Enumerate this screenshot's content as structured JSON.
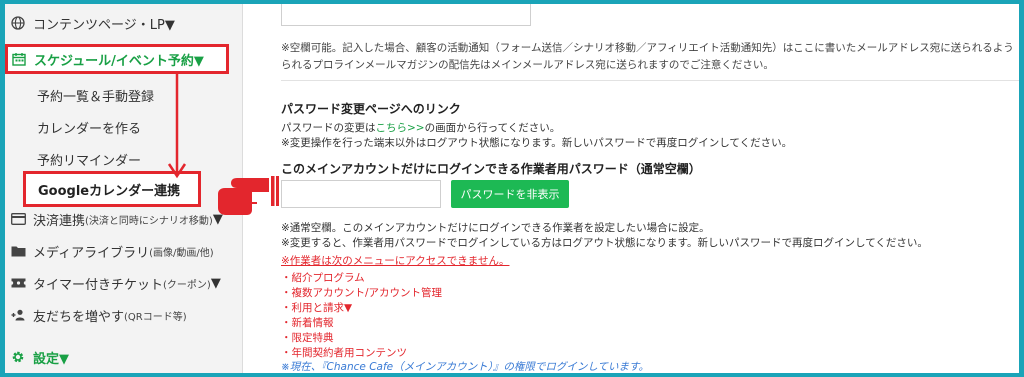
{
  "sidebar": {
    "items": [
      {
        "label": "コンテンツページ・LP▼",
        "icon": "globe-icon"
      },
      {
        "label": "スケジュール/イベント予約▼",
        "icon": "calendar-icon"
      },
      {
        "label": "決済連携",
        "small": "(決済と同時にシナリオ移動)",
        "suffix": "▼",
        "icon": "credit-card-icon"
      },
      {
        "label": "メディアライブラリ",
        "small": "(画像/動画/他)",
        "suffix": "",
        "icon": "folder-icon"
      },
      {
        "label": "タイマー付きチケット",
        "small": "(クーポン)",
        "suffix": "▼",
        "icon": "ticket-icon"
      },
      {
        "label": "友だちを増やす",
        "small": "(QRコード等)",
        "suffix": "",
        "icon": "add-user-icon"
      },
      {
        "label": "設定▼",
        "icon": "gear-icon"
      }
    ],
    "subitems": [
      "予約一覧＆手動登録",
      "カレンダーを作る",
      "予約リマインダー",
      "Googleカレンダー連携"
    ]
  },
  "main": {
    "note1": "※空欄可能。記入した場合、顧客の活動通知（フォーム送信／シナリオ移動／アフィリエイト活動通知先）はここに書いたメールアドレス宛に送られるよう",
    "note2": "られるプロラインメールマガジンの配信先はメインメールアドレス宛に送られますのでご注意ください。",
    "pw_change_heading": "パスワード変更ページへのリンク",
    "pw_change_prefix": "パスワードの変更は",
    "pw_change_link": "こちら>>",
    "pw_change_suffix": "の画面から行ってください。",
    "pw_change_note": "※変更操作を行った端末以外はログアウト状態になります。新しいパスワードで再度ログインしてください。",
    "worker_pw_heading": "このメインアカウントだけにログインできる作業者用パスワード（通常空欄）",
    "hide_pw_button": "パスワードを非表示",
    "worker_note1": "※通常空欄。このメインアカウントだけにログインできる作業者を設定したい場合に設定。",
    "worker_note2": "※変更すると、作業者用パスワードでログインしている方はログアウト状態になります。新しいパスワードで再度ログインしてください。",
    "restriction_title": "※作業者は次のメニューにアクセスできません。",
    "restrictions": [
      "・紹介プログラム",
      "・複数アカウント/アカウント管理",
      "・利用と請求▼",
      "・新着情報",
      "・限定特典",
      "・年間契約者用コンテンツ"
    ],
    "current_login": "※現在、『Chance Cafe（メインアカウント）』の権限でログインしています。"
  },
  "colors": {
    "accent_red": "#e3262d",
    "accent_green": "#19a045",
    "button_green": "#1db954",
    "frame_teal": "#1aa4b8",
    "info_blue": "#3a7bd5"
  }
}
